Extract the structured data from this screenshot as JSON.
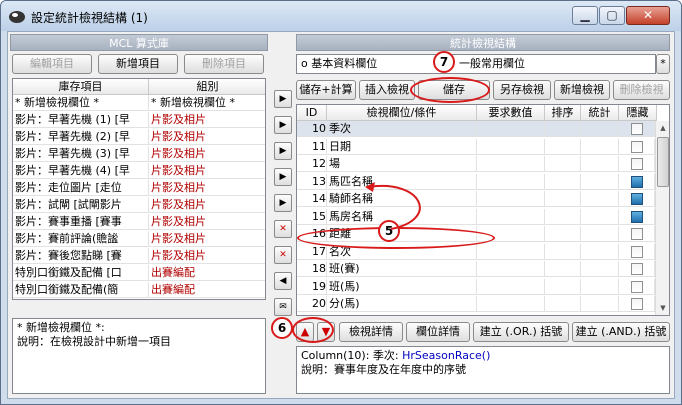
{
  "window": {
    "title": "設定統計檢視結構 (1)"
  },
  "left": {
    "header": "MCL 算式庫",
    "buttons": {
      "edit": "編輯項目",
      "new": "新增項目",
      "delete": "刪除項目"
    },
    "columns": [
      "庫存項目",
      "組別"
    ],
    "rows": [
      [
        "* 新增檢視欄位 *",
        "* 新增檢視欄位 *"
      ],
      [
        "影片：早著先機 (1) [早",
        "片影及相片"
      ],
      [
        "影片：早著先機 (2) [早",
        "片影及相片"
      ],
      [
        "影片：早著先機 (3) [早",
        "片影及相片"
      ],
      [
        "影片：早著先機 (4) [早",
        "片影及相片"
      ],
      [
        "影片：走位圖片 [走位",
        "片影及相片"
      ],
      [
        "影片：試閘 [試閘影片",
        "片影及相片"
      ],
      [
        "影片：賽事重播 [賽事",
        "片影及相片"
      ],
      [
        "影片：賽前評論(贍謐",
        "片影及相片"
      ],
      [
        "影片：賽後您點睇 [賽",
        "片影及相片"
      ],
      [
        "特別口銜鐵及配備 [口",
        "出賽編配"
      ],
      [
        "特別口銜鐵及配備(簡",
        "出賽編配"
      ]
    ],
    "desc_line1": "* 新增檢視欄位 *:",
    "desc_line2": "說明：在檢視設計中新增一項目"
  },
  "right": {
    "header": "統計檢視結構",
    "view_name": "o 基本資料欄位",
    "view_name2": "一般常用欄位",
    "star": "*",
    "buttons": {
      "save_calc": "儲存+計算",
      "insert": "插入檢視",
      "save": "儲存",
      "save_as": "另存檢視",
      "add_view": "新增檢視",
      "delete_view": "刪除檢視"
    },
    "columns": [
      "ID",
      "檢視欄位/條件",
      "要求數值",
      "排序",
      "統計",
      "隱藏"
    ],
    "rows": [
      {
        "id": "10",
        "name": "季次",
        "checked": false,
        "selected": true
      },
      {
        "id": "11",
        "name": "日期",
        "checked": false,
        "selected": false
      },
      {
        "id": "12",
        "name": "場",
        "checked": false,
        "selected": false
      },
      {
        "id": "13",
        "name": "馬匹名稱",
        "checked": true,
        "selected": false
      },
      {
        "id": "14",
        "name": "騎師名稱",
        "checked": true,
        "selected": false
      },
      {
        "id": "15",
        "name": "馬房名稱",
        "checked": true,
        "selected": false
      },
      {
        "id": "16",
        "name": "距離",
        "checked": false,
        "selected": false
      },
      {
        "id": "17",
        "name": "名次",
        "checked": false,
        "selected": false
      },
      {
        "id": "18",
        "name": "班(賽)",
        "checked": false,
        "selected": false
      },
      {
        "id": "19",
        "name": "班(馬)",
        "checked": false,
        "selected": false
      },
      {
        "id": "20",
        "name": "分(馬)",
        "checked": false,
        "selected": false
      }
    ],
    "bottom_buttons": {
      "view_detail": "檢視詳情",
      "field_detail": "欄位詳情",
      "or_bracket": "建立 (.OR.) 括號",
      "and_bracket": "建立 (.AND.) 括號"
    },
    "info_line1_prefix": "Column(10): 季次: ",
    "info_line1_func": "HrSeasonRace()",
    "info_line2": "說明：賽事年度及在年度中的序號"
  },
  "arrows": [
    "▶",
    "▶",
    "▶",
    "▶",
    "▶",
    "✕",
    "✕",
    "◀",
    "✉"
  ],
  "callouts": {
    "c5": "5",
    "c6": "6",
    "c7": "7"
  },
  "colors": {
    "callout": "#d91a1a",
    "header": "#a7b1bf",
    "selected_row": "#dde3ec",
    "checked": "#1f6fae",
    "red_text": "#b00000"
  }
}
